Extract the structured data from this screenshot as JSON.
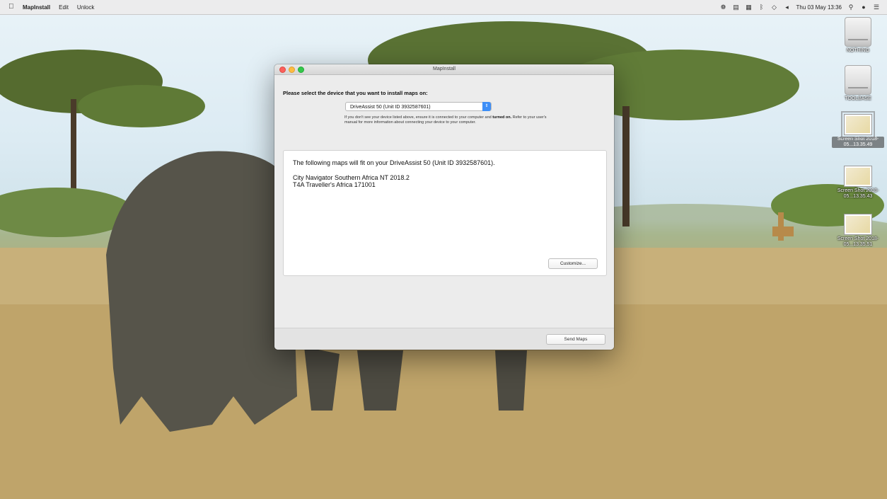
{
  "menubar": {
    "app_name": "MapInstall",
    "items": [
      "Edit",
      "Unlock"
    ],
    "clock": "Thu 03 May 13:36"
  },
  "desktop": {
    "icons": [
      {
        "label": "NOTHING",
        "kind": "disk"
      },
      {
        "label": "TOOLBASE",
        "kind": "disk"
      },
      {
        "label": "Screen Shot 2018-05...13.35.49",
        "kind": "screenshot",
        "selected": true
      },
      {
        "label": "Screen Shot 2018-05...13.35.43",
        "kind": "screenshot"
      },
      {
        "label": "Screen Shot 2018-05...13.35.51",
        "kind": "screenshot"
      }
    ]
  },
  "window": {
    "title": "MapInstall",
    "prompt": "Please select the device that you want to install maps on:",
    "device_selected": "DriveAssist 50 (Unit ID 3932587601)",
    "help_text_1": "If you don't see your device listed above, ensure it is connected to your computer and",
    "help_bold": "turned on.",
    "help_text_2": " Refer to your user's manual for more information about connecting your device to your computer.",
    "maps_header": "The following maps will fit on your DriveAssist 50 (Unit ID 3932587601).",
    "maps": [
      "City Navigator Southern Africa NT 2018.2",
      "T4A Traveller's Africa 171001"
    ],
    "customize_label": "Customize...",
    "send_label": "Send Maps"
  }
}
